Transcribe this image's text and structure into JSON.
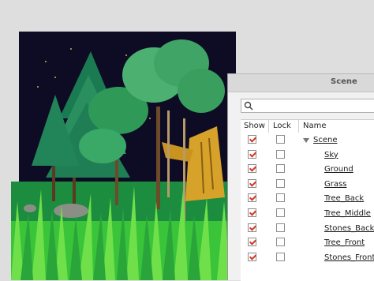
{
  "panel": {
    "title": "Scene",
    "search": {
      "placeholder": "",
      "value": ""
    },
    "columns": {
      "show": "Show",
      "lock": "Lock",
      "name": "Name"
    },
    "layers": [
      {
        "name": "Scene",
        "show": true,
        "lock": false,
        "expanded": true,
        "depth": 0
      },
      {
        "name": "Sky",
        "show": true,
        "lock": false,
        "depth": 1
      },
      {
        "name": "Ground",
        "show": true,
        "lock": false,
        "depth": 1
      },
      {
        "name": "Grass",
        "show": true,
        "lock": false,
        "depth": 1
      },
      {
        "name": "Tree_Back",
        "show": true,
        "lock": false,
        "depth": 1
      },
      {
        "name": "Tree_Middle",
        "show": true,
        "lock": false,
        "depth": 1
      },
      {
        "name": "Stones_Back",
        "show": true,
        "lock": false,
        "depth": 1
      },
      {
        "name": "Tree_Front",
        "show": true,
        "lock": false,
        "depth": 1
      },
      {
        "name": "Stones_Front",
        "show": true,
        "lock": false,
        "depth": 1
      }
    ]
  },
  "colors": {
    "checkmark": "#d23a2a",
    "sky": "#0e0b24",
    "ground": "#1c8c3e",
    "grass": "#39c43a"
  },
  "icons": {
    "search": "search-icon",
    "expand": "triangle-down-icon"
  }
}
